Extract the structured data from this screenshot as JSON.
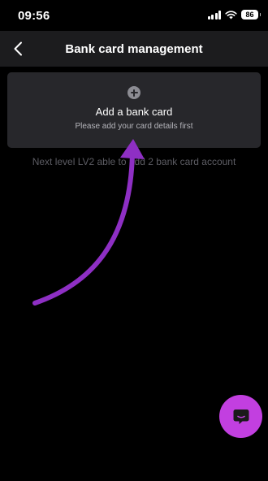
{
  "status_bar": {
    "time": "09:56",
    "battery": "86",
    "icons": [
      "signal-icon",
      "wifi-icon",
      "battery-icon"
    ]
  },
  "header": {
    "back_icon": "chevron-left-icon",
    "title": "Bank card management"
  },
  "add_card": {
    "icon": "plus-circle-icon",
    "title": "Add a bank card",
    "subtitle": "Please add your card details first"
  },
  "level_note": "Next level LV2 able to add 2 bank card account",
  "annotation": {
    "type": "arrow",
    "color": "#8e2fc4"
  },
  "chat_button": {
    "icon": "chat-icon",
    "color": "#c23fe0"
  },
  "colors": {
    "background": "#000000",
    "nav_bar": "#1c1c1e",
    "card": "#27272b",
    "muted_text": "#5c5c63"
  }
}
